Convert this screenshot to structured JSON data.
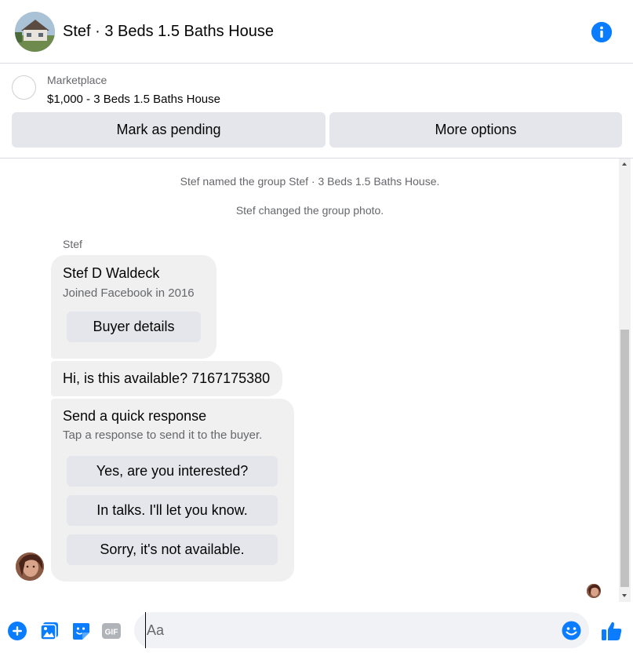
{
  "header": {
    "title": "Stef · 3 Beds 1.5 Baths House",
    "avatar_icon": "house-photo-avatar",
    "info_icon": "info-icon"
  },
  "marketplace": {
    "label": "Marketplace",
    "listing": "$1,000 - 3 Beds 1.5 Baths House",
    "mark_pending_label": "Mark as pending",
    "more_options_label": "More options"
  },
  "messages": {
    "system": [
      "Stef named the group Stef · 3 Beds 1.5 Baths House.",
      "Stef changed the group photo."
    ],
    "sender": "Stef",
    "buyer_card": {
      "name": "Stef D Waldeck",
      "joined": "Joined Facebook in 2016",
      "button": "Buyer details"
    },
    "text_message": "Hi, is this available? 7167175380",
    "quick_response": {
      "title": "Send a quick response",
      "subtitle": "Tap a response to send it to the buyer.",
      "options": [
        "Yes, are you interested?",
        "In talks. I'll let you know.",
        "Sorry, it's not available."
      ]
    }
  },
  "composer": {
    "placeholder": "Aa",
    "icons": [
      "plus-circle-icon",
      "photo-icon",
      "sticker-icon",
      "gif-icon",
      "emoji-icon",
      "thumbs-up-icon"
    ]
  },
  "colors": {
    "accent": "#0a7cff",
    "bubble": "#f0f0f0",
    "button": "#e4e6eb",
    "secondary_text": "#65676b"
  }
}
